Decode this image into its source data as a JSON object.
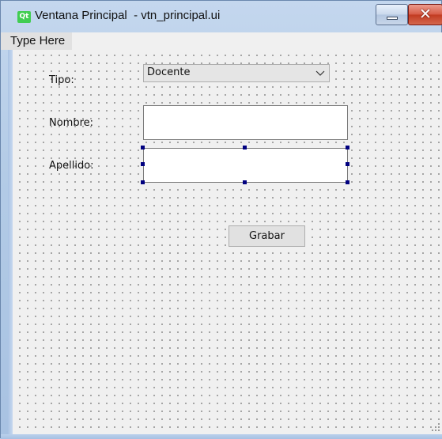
{
  "window": {
    "title": "Ventana Principal  - vtn_principal.ui",
    "logo_text": "Qt",
    "close_glyph": "✕"
  },
  "menubar": {
    "items": [
      "Type Here"
    ]
  },
  "form": {
    "tipo_label": "Tipo:",
    "tipo_value": "Docente",
    "nombre_label": "Nombre:",
    "nombre_value": "",
    "apellido_label": "Apellido:",
    "apellido_value": "",
    "grabar_label": "Grabar"
  },
  "icons": {
    "logo": "qt-logo-icon",
    "minimize": "minimize-icon",
    "close": "close-icon",
    "dropdown": "chevron-down-icon",
    "grip": "resize-grip-icon"
  },
  "colors": {
    "selection_handle": "#000080",
    "qt_green": "#41cd52",
    "close_red": "#c23b21"
  }
}
